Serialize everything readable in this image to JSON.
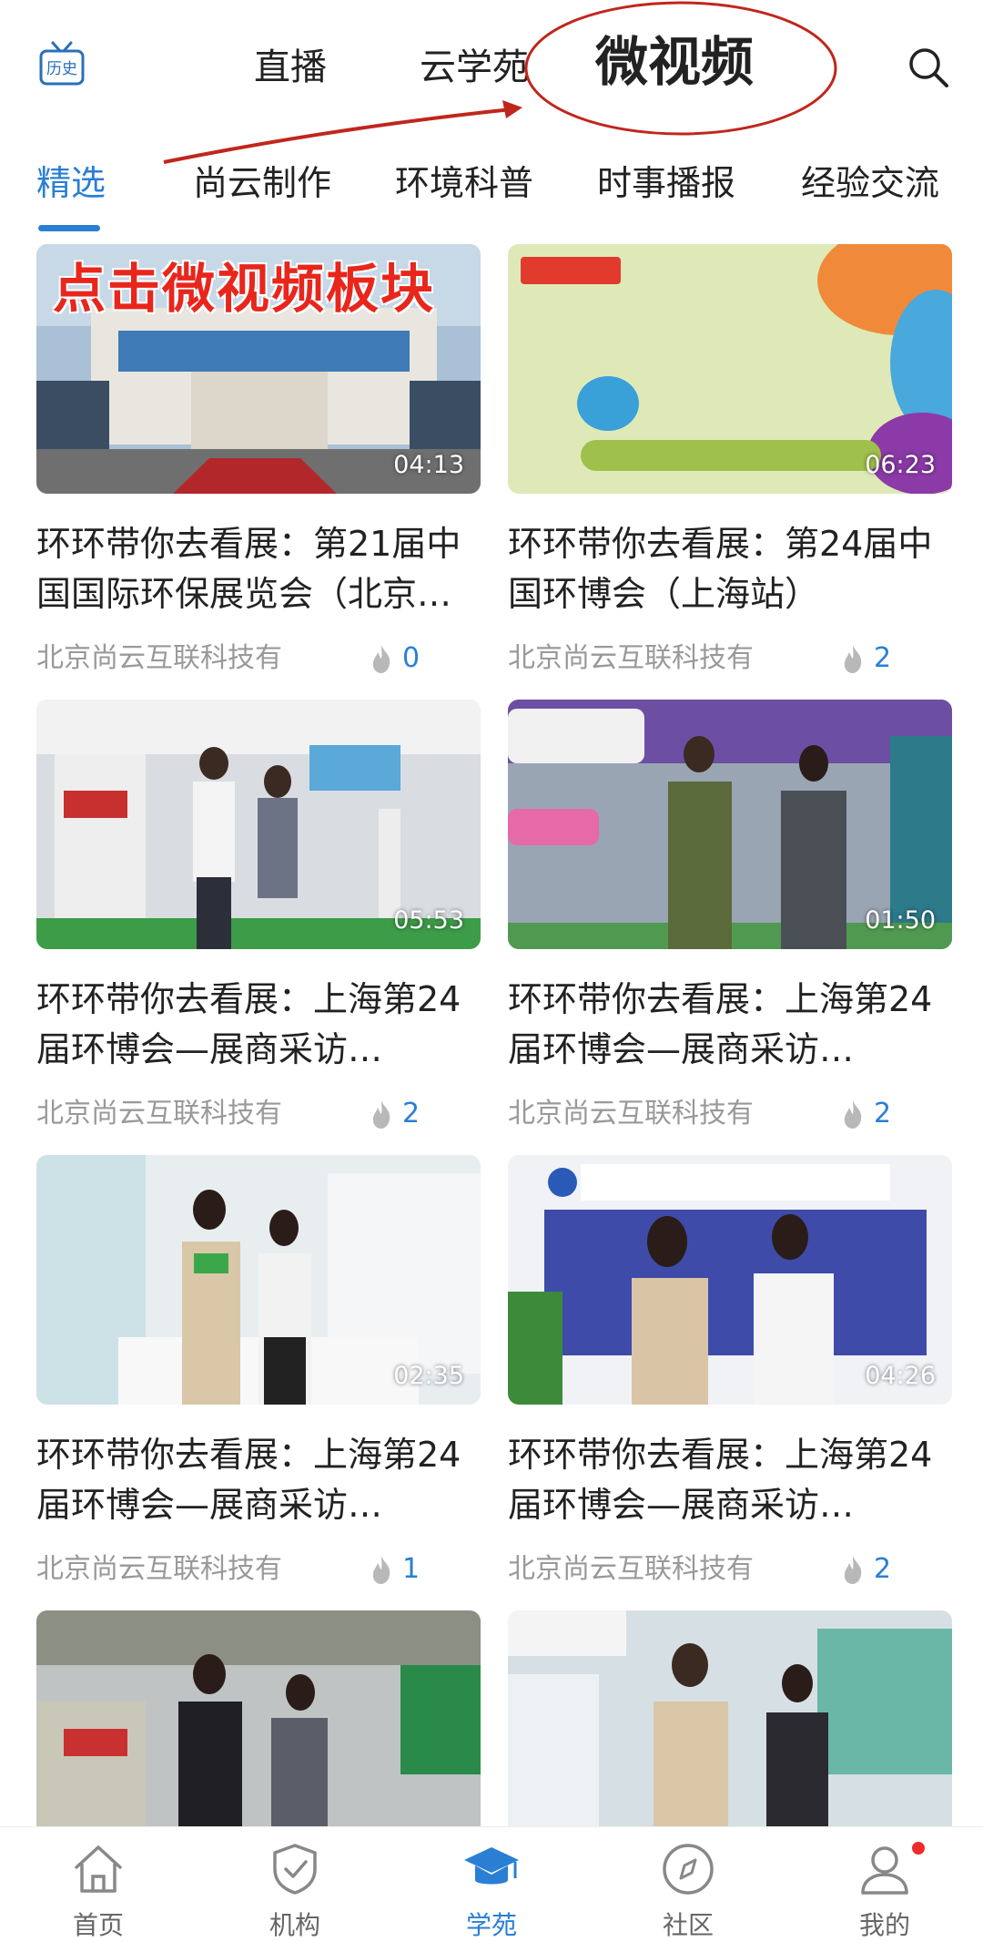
{
  "top_nav": {
    "history_label": "历史",
    "tabs": [
      "直播",
      "云学苑",
      "微视频"
    ],
    "active_tab": "微视频",
    "search_icon": "search-icon",
    "annotation_color": "#c0261c"
  },
  "sub_tabs": {
    "items": [
      "精选",
      "尚云制作",
      "环境科普",
      "时事播报",
      "经验交流"
    ],
    "active": "精选",
    "accent_color": "#2a7fd4"
  },
  "videos": [
    {
      "thumb_caption": "点击微视频板块",
      "duration": "04:13",
      "title": "环环带你去看展：第21届中国国际环保展览会（北京…",
      "author": "北京尚云互联科技有",
      "hot": "0"
    },
    {
      "thumb_caption": "",
      "duration": "06:23",
      "title": "环环带你去看展：第24届中国环博会（上海站）",
      "author": "北京尚云互联科技有",
      "hot": "2"
    },
    {
      "thumb_caption": "",
      "duration": "05:53",
      "title": "环环带你去看展：上海第24届环博会—展商采访…",
      "author": "北京尚云互联科技有",
      "hot": "2"
    },
    {
      "thumb_caption": "",
      "duration": "01:50",
      "title": "环环带你去看展：上海第24届环博会—展商采访…",
      "author": "北京尚云互联科技有",
      "hot": "2"
    },
    {
      "thumb_caption": "",
      "duration": "02:35",
      "title": "环环带你去看展：上海第24届环博会—展商采访…",
      "author": "北京尚云互联科技有",
      "hot": "1"
    },
    {
      "thumb_caption": "",
      "duration": "04:26",
      "title": "环环带你去看展：上海第24届环博会—展商采访…",
      "author": "北京尚云互联科技有",
      "hot": "2"
    },
    {
      "thumb_caption": "",
      "duration": "",
      "title": "",
      "author": "",
      "hot": ""
    },
    {
      "thumb_caption": "",
      "duration": "",
      "title": "",
      "author": "",
      "hot": ""
    }
  ],
  "bottom_nav": {
    "items": [
      {
        "label": "首页",
        "icon": "home-icon"
      },
      {
        "label": "机构",
        "icon": "shield-icon"
      },
      {
        "label": "学苑",
        "icon": "graduation-cap-icon"
      },
      {
        "label": "社区",
        "icon": "compass-icon"
      },
      {
        "label": "我的",
        "icon": "user-icon"
      }
    ],
    "active": "学苑",
    "badge_color": "#ee2a2a"
  }
}
